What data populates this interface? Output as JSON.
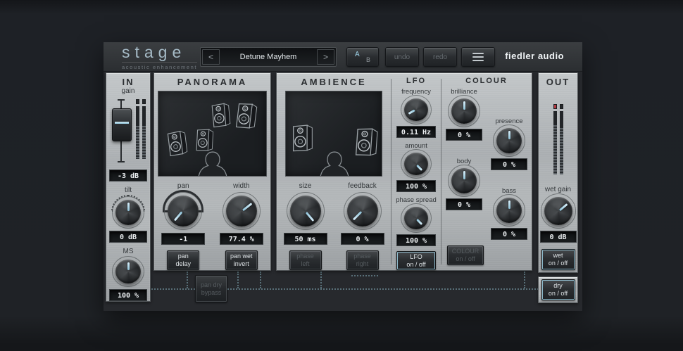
{
  "header": {
    "logo": "stage",
    "tagline": "acoustic enhancement",
    "preset_prev": "<",
    "preset_name": "Detune Mayhem",
    "preset_next": ">",
    "ab_a": "A",
    "ab_b": "B",
    "undo": "undo",
    "redo": "redo",
    "brand": "fiedler audio"
  },
  "in_panel": {
    "title": "IN",
    "gain_label": "gain",
    "gain_value": "-3 dB",
    "tilt_label": "tilt",
    "tilt_value": "0 dB",
    "ms_label": "MS",
    "ms_value": "100 %"
  },
  "panorama": {
    "title": "PANORAMA",
    "pan_label": "pan",
    "pan_value": "-1",
    "width_label": "width",
    "width_value": "77.4 %",
    "pan_delay_btn": "pan\ndelay",
    "pan_wet_invert_btn": "pan wet\ninvert"
  },
  "ambience": {
    "title": "AMBIENCE",
    "size_label": "size",
    "size_value": "50 ms",
    "feedback_label": "feedback",
    "feedback_value": "0 %",
    "phase_left_btn": "phase\nleft",
    "phase_right_btn": "phase\nright"
  },
  "lfo": {
    "title": "LFO",
    "frequency_label": "frequency",
    "frequency_value": "0.11 Hz",
    "amount_label": "amount",
    "amount_value": "100 %",
    "phase_spread_label": "phase spread",
    "phase_spread_value": "100 %",
    "on_off_btn": "LFO\non / off"
  },
  "colour": {
    "title": "COLOUR",
    "brilliance_label": "brilliance",
    "brilliance_value": "0 %",
    "presence_label": "presence",
    "presence_value": "0 %",
    "body_label": "body",
    "body_value": "0 %",
    "bass_label": "bass",
    "bass_value": "0 %",
    "on_off_btn": "COLOUR\non / off"
  },
  "out_panel": {
    "title": "OUT",
    "wet_gain_label": "wet gain",
    "wet_gain_value": "0 dB",
    "wet_btn": "wet\non / off",
    "dry_btn": "dry\non / off"
  },
  "routing": {
    "bypass_btn": "pan dry\nbypass"
  },
  "colors": {
    "accent": "#9ed2e8",
    "clip_red": "#b23a42",
    "panel_metal": "#aeb2b5",
    "display_bg": "#111316"
  }
}
